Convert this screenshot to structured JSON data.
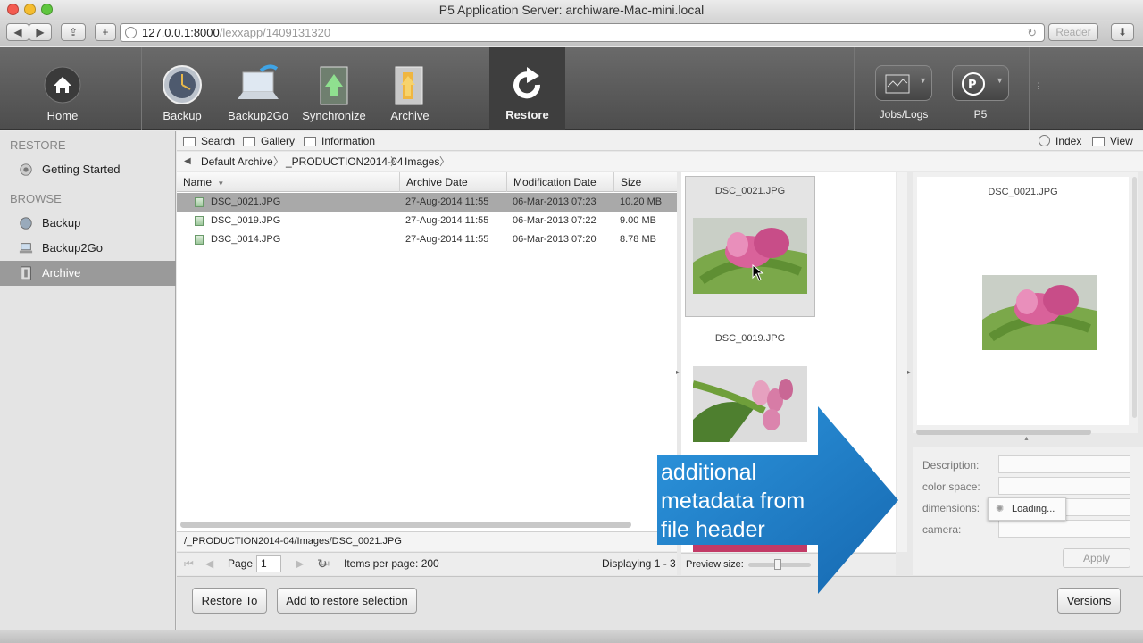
{
  "window": {
    "title": "P5 Application Server: archiware-Mac-mini.local",
    "url_host": "127.0.0.1:8000",
    "url_path": "/lexxapp/1409131320",
    "reader_label": "Reader"
  },
  "toolbar": {
    "home": "Home",
    "backup": "Backup",
    "backup2go": "Backup2Go",
    "synchronize": "Synchronize",
    "archive": "Archive",
    "restore": "Restore",
    "jobs_logs": "Jobs/Logs",
    "p5": "P5"
  },
  "sidebar": {
    "restore_header": "RESTORE",
    "getting_started": "Getting Started",
    "browse_header": "BROWSE",
    "items": [
      {
        "label": "Backup"
      },
      {
        "label": "Backup2Go"
      },
      {
        "label": "Archive"
      }
    ]
  },
  "subtoolbar": {
    "search": "Search",
    "gallery": "Gallery",
    "information": "Information",
    "index": "Index",
    "view": "View"
  },
  "breadcrumb": [
    "Default Archive",
    "_PRODUCTION2014-04",
    "Images"
  ],
  "table": {
    "columns": [
      "Name",
      "Archive Date",
      "Modification Date",
      "Size"
    ],
    "rows": [
      {
        "name": "DSC_0021.JPG",
        "archive_date": "27-Aug-2014 11:55",
        "mod_date": "06-Mar-2013 07:23",
        "size": "10.20 MB"
      },
      {
        "name": "DSC_0019.JPG",
        "archive_date": "27-Aug-2014 11:55",
        "mod_date": "06-Mar-2013 07:22",
        "size": "9.00 MB"
      },
      {
        "name": "DSC_0014.JPG",
        "archive_date": "27-Aug-2014 11:55",
        "mod_date": "06-Mar-2013 07:20",
        "size": "8.78 MB"
      }
    ]
  },
  "path": "/_PRODUCTION2014-04/Images/DSC_0021.JPG",
  "pager": {
    "page_label": "Page",
    "page_value": "1",
    "items_per_page": "Items per page: 200",
    "displaying": "Displaying 1 - 3"
  },
  "gallery": {
    "thumbs": [
      {
        "name": "DSC_0021.JPG"
      },
      {
        "name": "DSC_0019.JPG"
      }
    ],
    "preview_size_label": "Preview size:"
  },
  "preview": {
    "filename": "DSC_0021.JPG"
  },
  "metadata": {
    "description": "Description:",
    "color_space": "color space:",
    "dimensions": "dimensions:",
    "camera": "camera:",
    "loading": "Loading...",
    "apply": "Apply"
  },
  "buttons": {
    "restore_to": "Restore To",
    "add_to_selection": "Add to restore selection",
    "versions": "Versions"
  },
  "callout": {
    "line1": "additional",
    "line2": "metadata from",
    "line3": "file header"
  },
  "colors": {
    "callout_blue": "#1f7fc9",
    "selection_gray": "#a9a9a9",
    "toolbar_dark": "#555555"
  }
}
